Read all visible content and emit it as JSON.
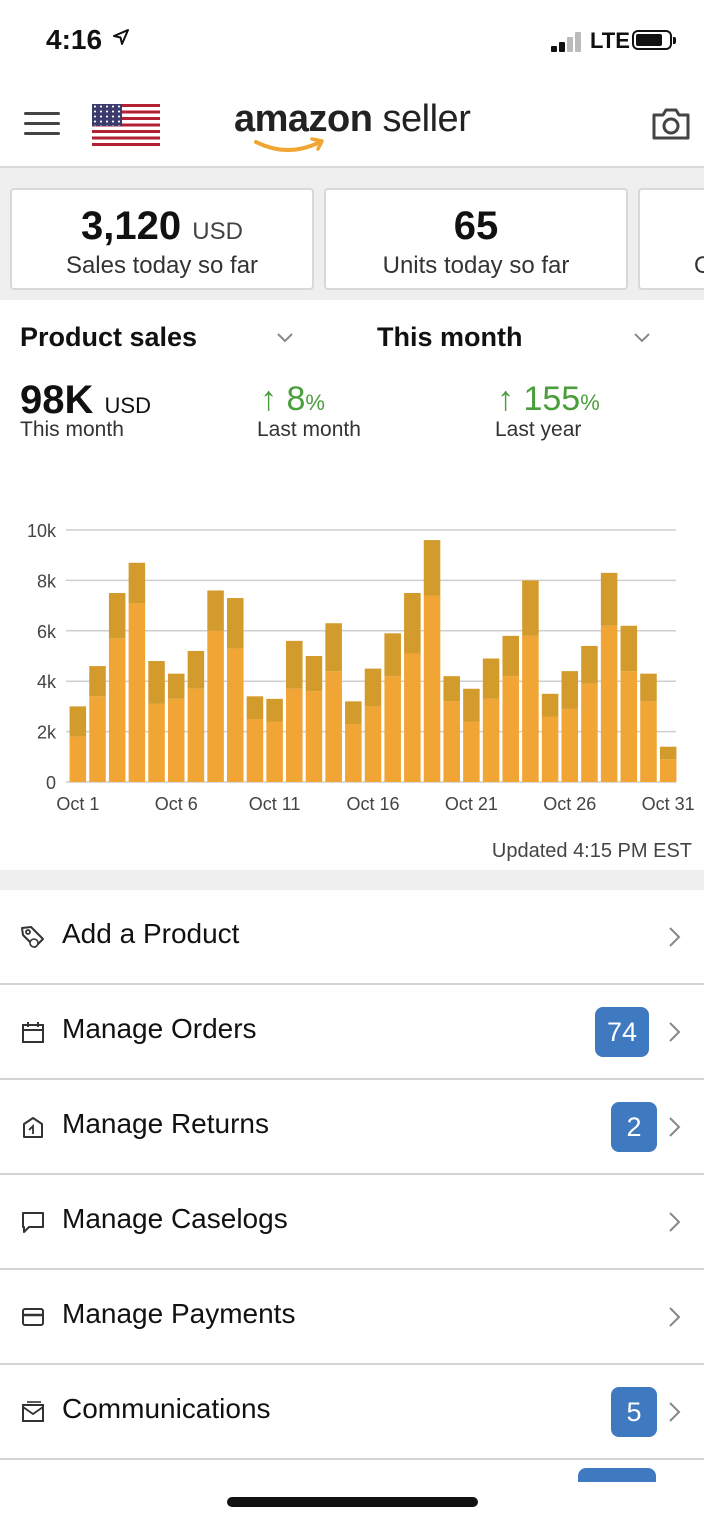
{
  "status_bar": {
    "time": "4:16",
    "network": "LTE"
  },
  "header": {
    "brand_bold": "amazon",
    "brand_light": " seller"
  },
  "stat_cards": [
    {
      "value": "3,120",
      "unit": "USD",
      "label": "Sales today so far"
    },
    {
      "value": "65",
      "unit": "",
      "label": "Units today so far"
    },
    {
      "value": "",
      "unit": "",
      "label": "O"
    }
  ],
  "selectors": {
    "metric": "Product sales",
    "period": "This month"
  },
  "metrics": {
    "current": {
      "value": "98K",
      "unit": "USD",
      "label": "This month"
    },
    "last_month": {
      "arrow": "↑",
      "value": "8",
      "unit": "%",
      "label": "Last month"
    },
    "last_year": {
      "arrow": "↑",
      "value": "155",
      "unit": "%",
      "label": "Last year"
    }
  },
  "chart_data": {
    "type": "bar",
    "stacked": true,
    "categories": [
      "Oct 1",
      "Oct 2",
      "Oct 3",
      "Oct 4",
      "Oct 5",
      "Oct 6",
      "Oct 7",
      "Oct 8",
      "Oct 9",
      "Oct 10",
      "Oct 11",
      "Oct 12",
      "Oct 13",
      "Oct 14",
      "Oct 15",
      "Oct 16",
      "Oct 17",
      "Oct 18",
      "Oct 19",
      "Oct 20",
      "Oct 21",
      "Oct 22",
      "Oct 23",
      "Oct 24",
      "Oct 25",
      "Oct 26",
      "Oct 27",
      "Oct 28",
      "Oct 29",
      "Oct 30",
      "Oct 31"
    ],
    "series": [
      {
        "values": [
          1800,
          3400,
          5700,
          7100,
          3100,
          3300,
          3700,
          6000,
          5300,
          2500,
          2400,
          3700,
          3600,
          4400,
          2300,
          3000,
          4200,
          5100,
          7400,
          3200,
          2400,
          3300,
          4200,
          5800,
          2600,
          2900,
          3900,
          6200,
          4400,
          3200,
          900
        ]
      },
      {
        "values": [
          1200,
          1200,
          1800,
          1600,
          1700,
          1000,
          1500,
          1600,
          2000,
          900,
          900,
          1900,
          1400,
          1900,
          900,
          1500,
          1700,
          2400,
          2200,
          1000,
          1300,
          1600,
          1600,
          2200,
          900,
          1500,
          1500,
          2100,
          1800,
          1100,
          500
        ]
      }
    ],
    "totals": [
      3000,
      4600,
      7500,
      8700,
      4800,
      4300,
      5200,
      7600,
      7300,
      3400,
      3300,
      5600,
      5000,
      6300,
      3200,
      4500,
      5900,
      7500,
      9600,
      4200,
      3700,
      4900,
      5800,
      8000,
      3500,
      4400,
      5400,
      8300,
      6200,
      4300,
      1400
    ],
    "x_tick_labels": [
      "Oct 1",
      "Oct 6",
      "Oct 11",
      "Oct 16",
      "Oct 21",
      "Oct 26",
      "Oct 31"
    ],
    "y_tick_labels": [
      "0",
      "2k",
      "4k",
      "6k",
      "8k",
      "10k"
    ],
    "ylim": [
      0,
      10000
    ],
    "grid": true,
    "colors": {
      "lower": "#f0a535",
      "upper": "#d39a2c",
      "grid": "#cfcfcf"
    }
  },
  "updated_text": "Updated 4:15 PM EST",
  "menu": [
    {
      "icon": "tag-icon",
      "label": "Add a Product",
      "badge": ""
    },
    {
      "icon": "calendar-icon",
      "label": "Manage Orders",
      "badge": "74"
    },
    {
      "icon": "return-box-icon",
      "label": "Manage Returns",
      "badge": "2"
    },
    {
      "icon": "message-icon",
      "label": "Manage Caselogs",
      "badge": ""
    },
    {
      "icon": "card-icon",
      "label": "Manage Payments",
      "badge": ""
    },
    {
      "icon": "mail-icon",
      "label": "Communications",
      "badge": "5"
    }
  ],
  "colors": {
    "accent": "#3f79c0",
    "positive": "#4a9e3b",
    "amazon_orange": "#f0a535"
  }
}
